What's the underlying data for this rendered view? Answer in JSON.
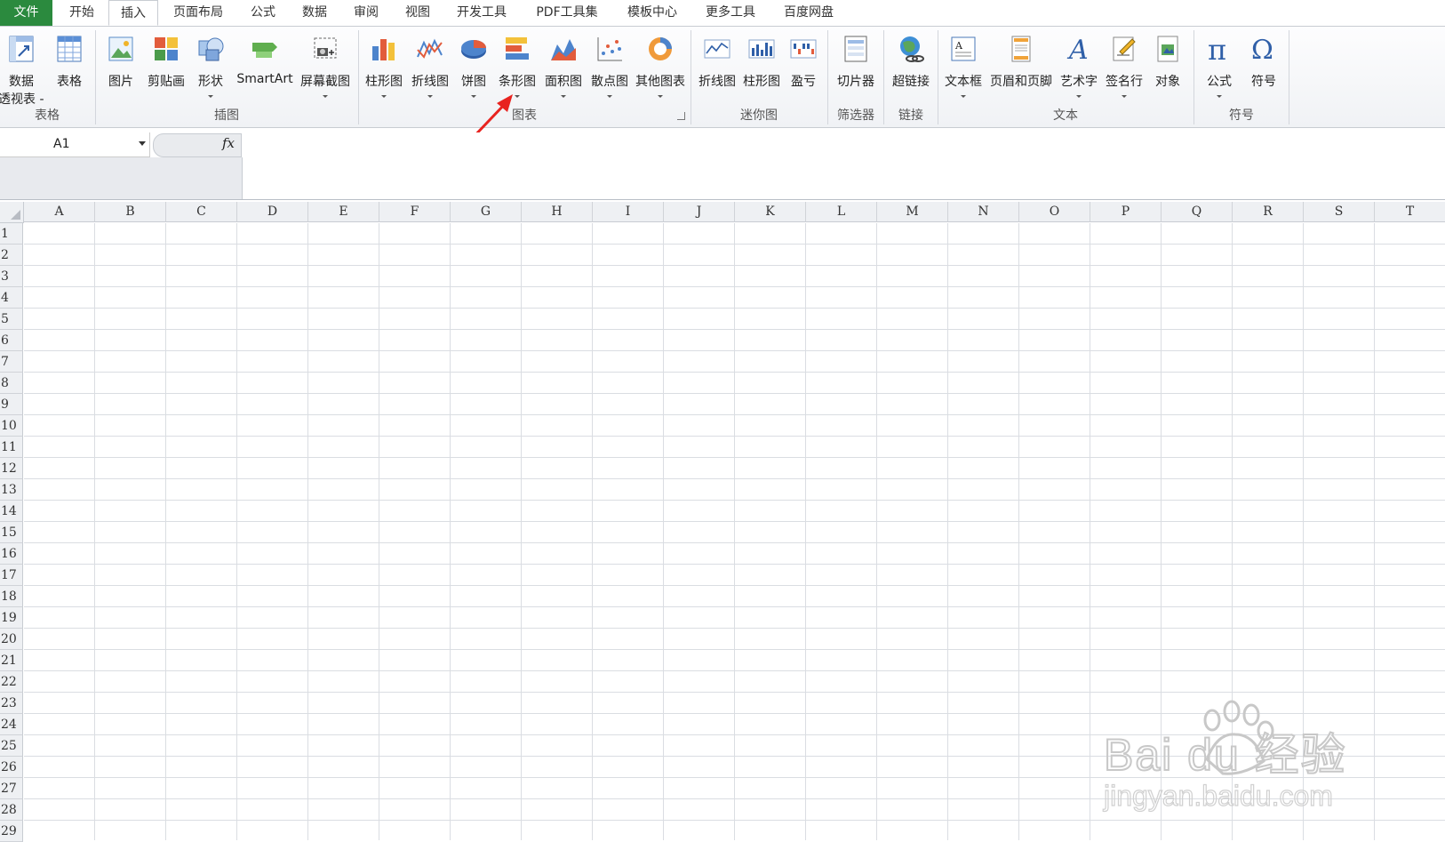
{
  "tabs": [
    "文件",
    "开始",
    "插入",
    "页面布局",
    "公式",
    "数据",
    "审阅",
    "视图",
    "开发工具",
    "PDF工具集",
    "模板中心",
    "更多工具",
    "百度网盘"
  ],
  "ribbon": {
    "buttons": [
      {
        "label": "数据",
        "label2": "透视表 -",
        "icon": "pivot-table-icon"
      },
      {
        "label": "表格",
        "icon": "table-icon"
      },
      {
        "label": "图片",
        "icon": "picture-icon"
      },
      {
        "label": "剪贴画",
        "icon": "clipart-icon"
      },
      {
        "label": "形状",
        "icon": "shapes-icon"
      },
      {
        "label": "SmartArt",
        "icon": "smartart-icon"
      },
      {
        "label": "屏幕截图",
        "icon": "screenshot-icon"
      },
      {
        "label": "柱形图",
        "icon": "column-chart-icon"
      },
      {
        "label": "折线图",
        "icon": "line-chart-icon"
      },
      {
        "label": "饼图",
        "icon": "pie-chart-icon"
      },
      {
        "label": "条形图",
        "icon": "bar-chart-icon"
      },
      {
        "label": "面积图",
        "icon": "area-chart-icon"
      },
      {
        "label": "散点图",
        "icon": "scatter-chart-icon"
      },
      {
        "label": "其他图表",
        "icon": "other-charts-icon"
      },
      {
        "label": "折线图",
        "icon": "sparkline-line-icon"
      },
      {
        "label": "柱形图",
        "icon": "sparkline-column-icon"
      },
      {
        "label": "盈亏",
        "icon": "sparkline-winloss-icon"
      },
      {
        "label": "切片器",
        "icon": "slicer-icon"
      },
      {
        "label": "超链接",
        "icon": "hyperlink-icon"
      },
      {
        "label": "文本框",
        "icon": "textbox-icon"
      },
      {
        "label": "页眉和页脚",
        "icon": "header-footer-icon"
      },
      {
        "label": "艺术字",
        "icon": "wordart-icon"
      },
      {
        "label": "签名行",
        "icon": "signature-line-icon"
      },
      {
        "label": "对象",
        "icon": "object-icon"
      },
      {
        "label": "公式",
        "icon": "equation-icon"
      },
      {
        "label": "符号",
        "icon": "symbol-icon"
      }
    ],
    "groups": [
      "表格",
      "插图",
      "图表",
      "迷你图",
      "筛选器",
      "链接",
      "文本",
      "符号"
    ]
  },
  "formula_bar": {
    "name_box": "A1",
    "fx": "fx",
    "formula": ""
  },
  "columns": [
    "A",
    "B",
    "C",
    "D",
    "E",
    "F",
    "G",
    "H",
    "I",
    "J",
    "K",
    "L",
    "M",
    "N",
    "O",
    "P",
    "Q",
    "R",
    "S",
    "T"
  ],
  "rows": [
    "1",
    "2",
    "3",
    "4",
    "5",
    "6",
    "7",
    "8",
    "9",
    "10",
    "11",
    "12",
    "13",
    "14",
    "15",
    "16",
    "17",
    "18",
    "19",
    "20",
    "21",
    "22",
    "23",
    "24",
    "25",
    "26",
    "27",
    "28",
    "29"
  ],
  "watermark": {
    "brand": "Bai du 经验",
    "url": "jingyan.baidu.com"
  },
  "colors": {
    "file_tab": "#2b8a3e",
    "arrow": "#e8231f"
  }
}
